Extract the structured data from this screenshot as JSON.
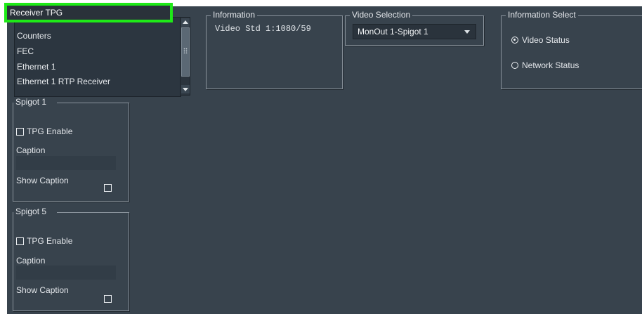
{
  "list": {
    "items": [
      "Receiver TPG",
      "Counters",
      "FEC",
      "Ethernet 1",
      "Ethernet 1 RTP Receiver"
    ],
    "selected_index": 0
  },
  "information": {
    "title": "Information",
    "text": "Video Std 1:1080/59"
  },
  "video_selection": {
    "title": "Video Selection",
    "selected": "MonOut 1-Spigot 1"
  },
  "information_select": {
    "title": "Information Select",
    "options": [
      "Video Status",
      "Network Status"
    ],
    "selected_index": 0
  },
  "spigots": [
    {
      "title": "Spigot 1",
      "tpg_label": "TPG Enable",
      "caption_label": "Caption",
      "caption_value": "",
      "show_caption_label": "Show Caption"
    },
    {
      "title": "Spigot 5",
      "tpg_label": "TPG Enable",
      "caption_label": "Caption",
      "caption_value": "",
      "show_caption_label": "Show Caption"
    }
  ],
  "colors": {
    "background": "#38434d",
    "selection_highlight": "#1eea17",
    "border": "#8a939c"
  }
}
